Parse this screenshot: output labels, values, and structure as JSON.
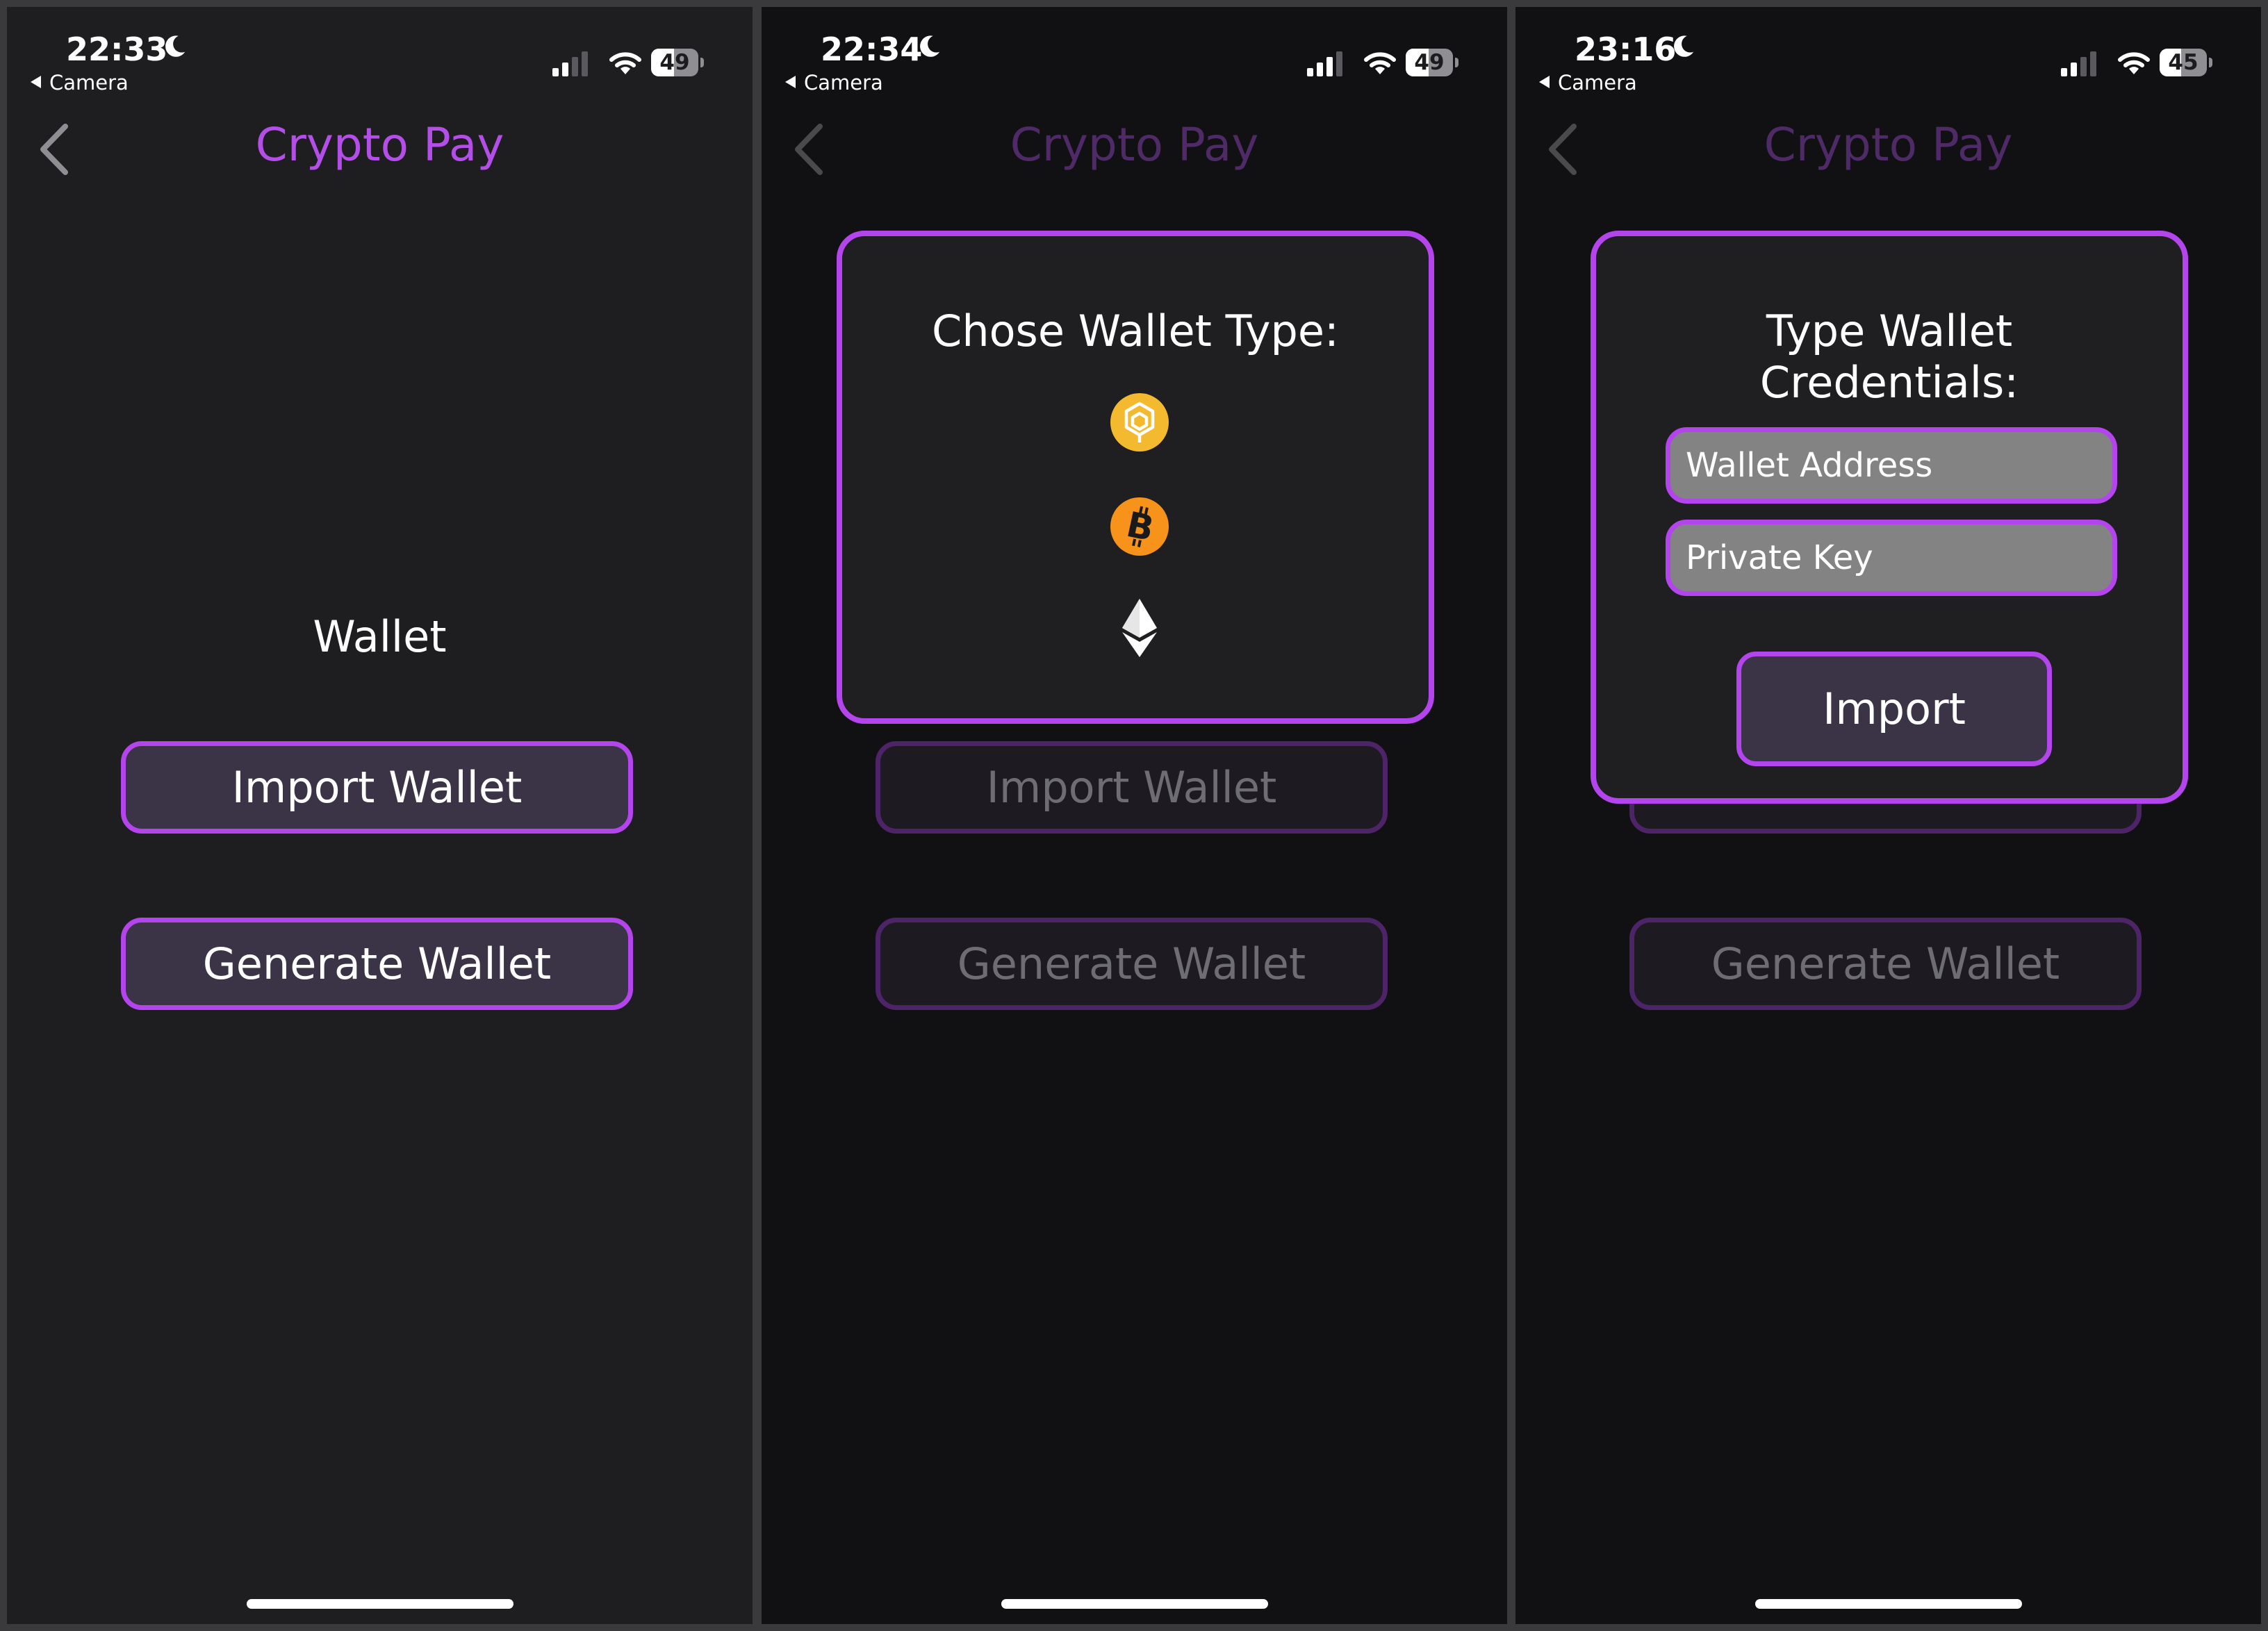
{
  "screens": [
    {
      "status": {
        "time": "22:33",
        "back_app": "Camera",
        "battery": "49",
        "battery_level": 0.49
      },
      "nav": {
        "title": "Crypto Pay"
      },
      "main": {
        "wallet_label": "Wallet",
        "import_wallet_label": "Import Wallet",
        "generate_wallet_label": "Generate Wallet"
      }
    },
    {
      "status": {
        "time": "22:34",
        "back_app": "Camera",
        "battery": "49",
        "battery_level": 0.49
      },
      "nav": {
        "title": "Crypto Pay"
      },
      "main": {
        "import_wallet_label": "Import Wallet",
        "generate_wallet_label": "Generate Wallet"
      },
      "dialog": {
        "title": "Chose Wallet Type:",
        "options": [
          {
            "icon": "binance-coin-icon",
            "color": "#f3ba2f"
          },
          {
            "icon": "bitcoin-icon",
            "color": "#f7931a"
          },
          {
            "icon": "ethereum-icon",
            "color": "#ffffff"
          }
        ]
      }
    },
    {
      "status": {
        "time": "23:16",
        "back_app": "Camera",
        "battery": "45",
        "battery_level": 0.45
      },
      "nav": {
        "title": "Crypto Pay"
      },
      "main": {
        "generate_wallet_label": "Generate Wallet"
      },
      "dialog": {
        "title_line1": "Type Wallet",
        "title_line2": "Credentials:",
        "address_placeholder": "Wallet Address",
        "private_key_placeholder": "Private Key",
        "import_label": "Import"
      }
    }
  ],
  "colors": {
    "accent": "#b444ec",
    "title_purple": "#b44ee8",
    "background": "#1e1e20",
    "dimmed_background": "#111113",
    "button_fill": "#3b3446",
    "field_fill": "#838384"
  }
}
